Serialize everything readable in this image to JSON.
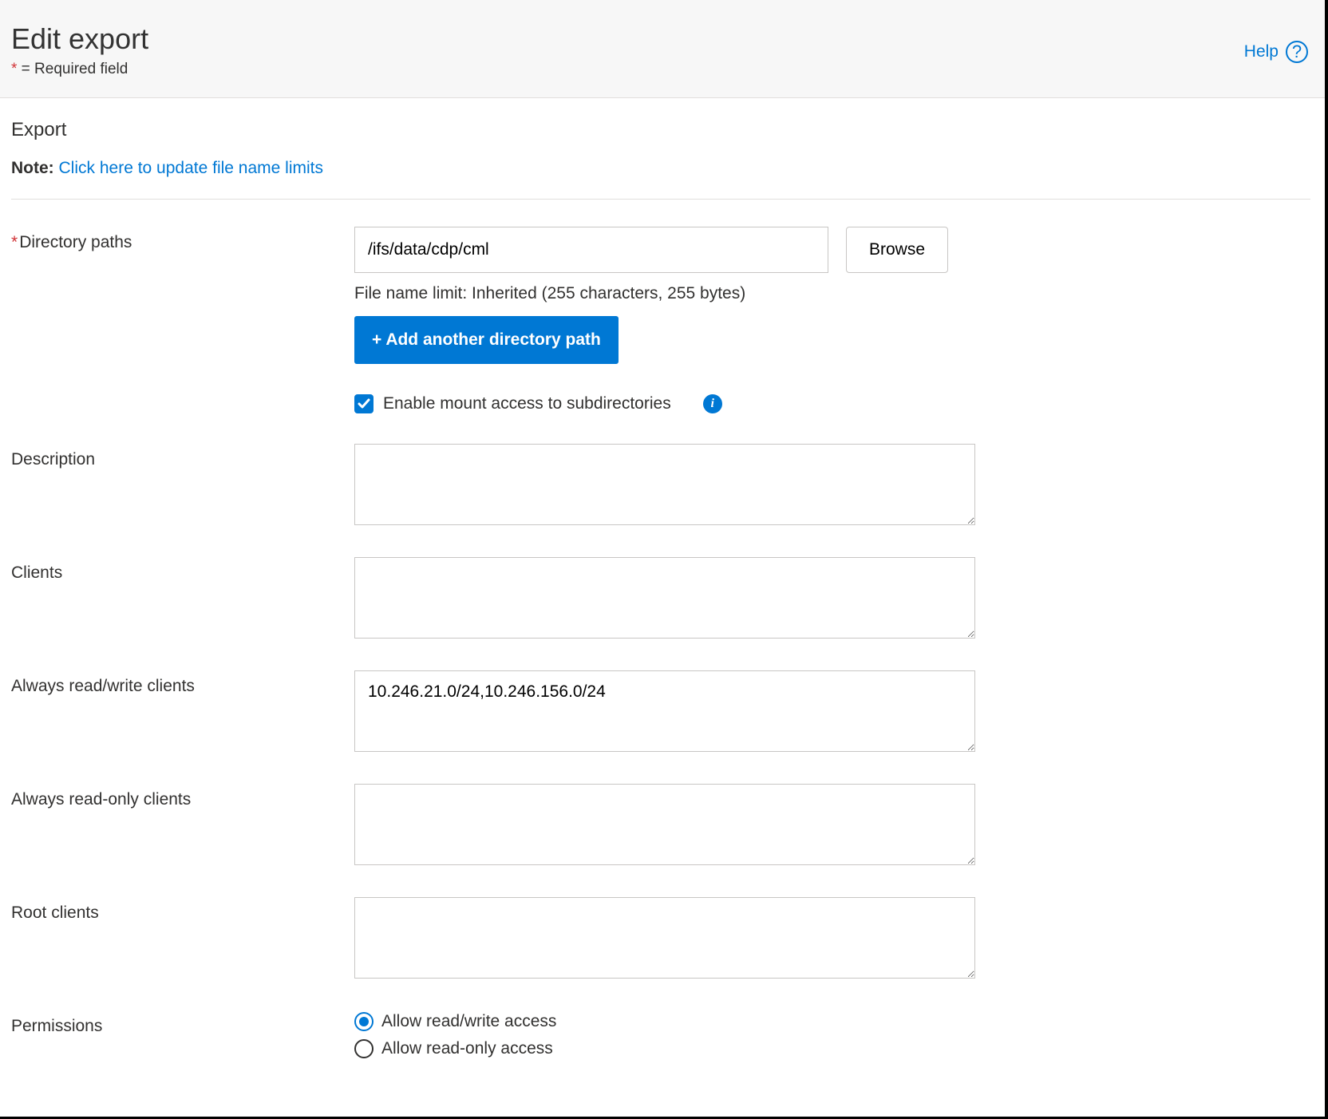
{
  "header": {
    "title": "Edit export",
    "required_mark": "*",
    "required_text": " = Required field",
    "help_label": "Help"
  },
  "section": {
    "title": "Export",
    "note_prefix": "Note:",
    "note_link": "Click here to update file name limits"
  },
  "form": {
    "directory_paths": {
      "label": "Directory paths",
      "value": "/ifs/data/cdp/cml",
      "browse_label": "Browse",
      "file_limit": "File name limit: Inherited (255 characters, 255 bytes)",
      "add_label": "+ Add another directory path",
      "mount_checkbox_checked": true,
      "mount_checkbox_label": "Enable mount access to subdirectories"
    },
    "description": {
      "label": "Description",
      "value": ""
    },
    "clients": {
      "label": "Clients",
      "value": ""
    },
    "rw_clients": {
      "label": "Always read/write clients",
      "value": "10.246.21.0/24,10.246.156.0/24"
    },
    "ro_clients": {
      "label": "Always read-only clients",
      "value": ""
    },
    "root_clients": {
      "label": "Root clients",
      "value": ""
    },
    "permissions": {
      "label": "Permissions",
      "selected": "rw",
      "option_rw": "Allow read/write access",
      "option_ro": "Allow read-only access"
    }
  }
}
